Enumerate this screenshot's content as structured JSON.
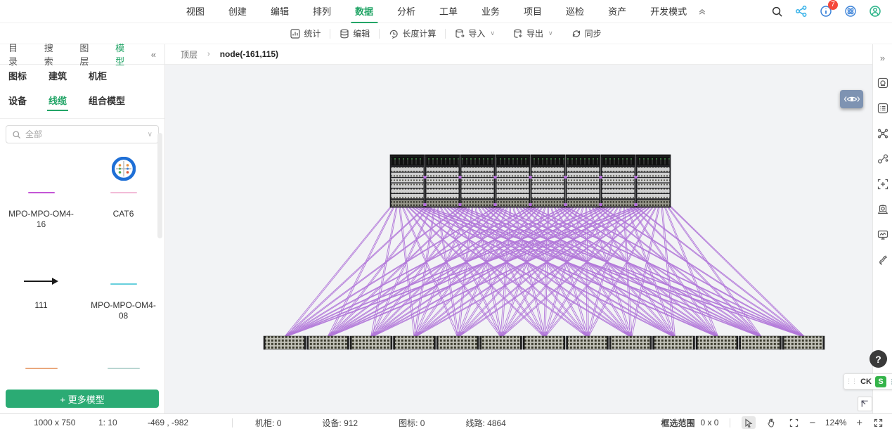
{
  "accent_color": "#23a567",
  "topnav": {
    "items": [
      "视图",
      "创建",
      "编辑",
      "排列",
      "数据",
      "分析",
      "工单",
      "业务",
      "项目",
      "巡检",
      "资产",
      "开发模式"
    ],
    "active_item": "数据",
    "notification_badge": "7"
  },
  "toolbar": {
    "stats": "统计",
    "edit": "编辑",
    "length_calc": "长度计算",
    "import": "导入",
    "export": "导出",
    "sync": "同步"
  },
  "sidebar": {
    "tabs": [
      "目录",
      "搜索",
      "图层",
      "模型"
    ],
    "active_tab": "模型",
    "subtabs": [
      "图标",
      "建筑",
      "机柜",
      "设备",
      "线缆",
      "组合模型"
    ],
    "active_subtab": "线缆",
    "search_placeholder": "全部",
    "models": [
      {
        "label": "MPO-MPO-OM4-16",
        "type": "line",
        "color": "#c455d6"
      },
      {
        "label": "CAT6",
        "type": "cat6",
        "color": "#f2bcd8"
      },
      {
        "label": "111",
        "type": "arrow",
        "color": "#1a1a1a"
      },
      {
        "label": "MPO-MPO-OM4-08",
        "type": "line",
        "color": "#68d0dd"
      },
      {
        "label": "",
        "type": "line",
        "color": "#eaa87d"
      },
      {
        "label": "",
        "type": "line",
        "color": "#b9d6d1"
      },
      {
        "label": "",
        "type": "arrow",
        "color": "#a5d823"
      },
      {
        "label": "",
        "type": "line",
        "color": "#4b38dd"
      }
    ],
    "more_button": "+ 更多模型"
  },
  "breadcrumb": {
    "root": "顶层",
    "separator": "›",
    "current": "node(-161,115)"
  },
  "floating": {
    "help": "?",
    "ime_label": "CK",
    "ime_s": "S"
  },
  "statusbar": {
    "canvas_size": "1000 x 750",
    "scale": "1: 10",
    "position": "-469 , -982",
    "counters": [
      {
        "label": "机柜",
        "value": "0"
      },
      {
        "label": "设备",
        "value": "912"
      },
      {
        "label": "图标",
        "value": "0"
      },
      {
        "label": "线路",
        "value": "4864"
      }
    ],
    "selection_label": "框选范围",
    "selection_value": "0 x 0",
    "zoom_level": "124%",
    "zoom_out": "−",
    "zoom_in": "+"
  },
  "topology": {
    "spine_count": 8,
    "leaf_count": 13,
    "line_color": "#a35ad3"
  }
}
